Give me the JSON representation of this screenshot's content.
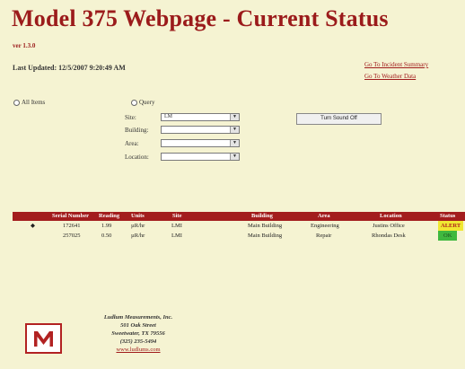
{
  "header": {
    "title": "Model 375 Webpage - Current Status",
    "version": "ver 1.3.0",
    "last_updated": "Last Updated: 12/5/2007 9:20:49 AM"
  },
  "links": {
    "incident_summary": "Go To Incident Summary",
    "weather_data": "Go To Weather Data"
  },
  "filters": {
    "all_items_label": "All Items",
    "query_label": "Query",
    "site_label": "Site:",
    "site_value": "LM",
    "building_label": "Building:",
    "area_label": "Area:",
    "location_label": "Location:"
  },
  "turn_sound_off_label": "Turn Sound Off",
  "table": {
    "headers": [
      "Serial Number",
      "Reading",
      "Units",
      "Site",
      "Building",
      "Area",
      "Location",
      "Status"
    ],
    "rows": [
      {
        "marker": "◆",
        "serial": "172641",
        "reading": "1.99",
        "units": "µR/hr",
        "site": "LMI",
        "building": "Main Building",
        "area": "Engineering",
        "location": "Justins Office",
        "status": "ALERT"
      },
      {
        "marker": "",
        "serial": "257025",
        "reading": "0.50",
        "units": "µR/hr",
        "site": "LMI",
        "building": "Main Building",
        "area": "Repair",
        "location": "Rhondas Desk",
        "status": "OK"
      }
    ]
  },
  "company": {
    "name": "Ludlum Measurements, Inc.",
    "street": "501 Oak Street",
    "city": "Sweetwater, TX 79556",
    "phone": "(325) 235-5494",
    "website": "www.ludlums.com"
  },
  "colors": {
    "background": "#f5f3d2",
    "title": "#9b1b1b",
    "header_bar": "#a31d1d",
    "alert": "#f0e832",
    "ok": "#3fb83f"
  }
}
